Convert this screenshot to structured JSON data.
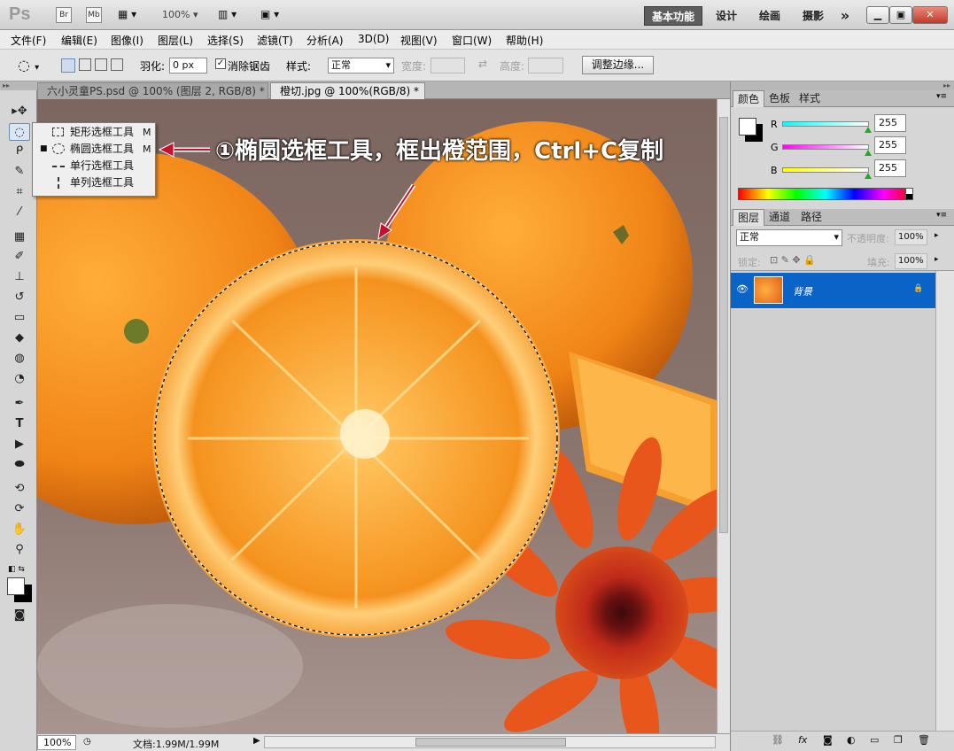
{
  "app": {
    "logo": "Ps",
    "icons": [
      "Br",
      "Mb"
    ],
    "zoom": "100%",
    "workspaces": [
      "基本功能",
      "设计",
      "绘画",
      "摄影"
    ],
    "more": "»"
  },
  "window_controls": {
    "minimize": "▁",
    "restore": "▣",
    "close": "✕"
  },
  "menu": [
    "文件(F)",
    "编辑(E)",
    "图像(I)",
    "图层(L)",
    "选择(S)",
    "滤镜(T)",
    "分析(A)",
    "3D(D)",
    "视图(V)",
    "窗口(W)",
    "帮助(H)"
  ],
  "options": {
    "feather_label": "羽化:",
    "feather_value": "0 px",
    "antialias_label": "消除锯齿",
    "style_label": "样式:",
    "style_value": "正常",
    "width_label": "宽度:",
    "height_label": "高度:",
    "refine_button": "调整边缘..."
  },
  "tabs": [
    {
      "label": "六小灵童PS.psd @ 100% (图层 2, RGB/8) *",
      "close": "✕"
    },
    {
      "label": "橙切.jpg @ 100%(RGB/8) *",
      "close": "✕"
    }
  ],
  "flyout": [
    {
      "label": "矩形选框工具",
      "key": "M",
      "icon": "rect-marquee-icon"
    },
    {
      "label": "椭圆选框工具",
      "key": "M",
      "icon": "ellipse-marquee-icon",
      "selected": true
    },
    {
      "label": "单行选框工具",
      "key": "",
      "icon": "single-row-marquee-icon"
    },
    {
      "label": "单列选框工具",
      "key": "",
      "icon": "single-column-marquee-icon"
    }
  ],
  "annotation": "①椭圆选框工具，框出橙范围，Ctrl+C复制",
  "status": {
    "zoom": "100%",
    "doc": "文档:1.99M/1.99M"
  },
  "color_panel": {
    "tabs": [
      "颜色",
      "色板",
      "样式"
    ],
    "channels": [
      {
        "name": "R",
        "value": "255"
      },
      {
        "name": "G",
        "value": "255"
      },
      {
        "name": "B",
        "value": "255"
      }
    ]
  },
  "layers_panel": {
    "tabs": [
      "图层",
      "通道",
      "路径"
    ],
    "blend_mode": "正常",
    "opacity_label": "不透明度:",
    "opacity_value": "100%",
    "lock_label": "锁定:",
    "fill_label": "填充:",
    "fill_value": "100%",
    "layers": [
      {
        "name": "背景",
        "locked": true
      }
    ],
    "footer_icons": [
      "link-icon",
      "fx-icon",
      "mask-icon",
      "adjustment-icon",
      "group-icon",
      "new-layer-icon",
      "trash-icon"
    ]
  },
  "colors": {
    "selection": "#0a64c8",
    "orange": "#f08a1e",
    "accent": "#d04020"
  }
}
